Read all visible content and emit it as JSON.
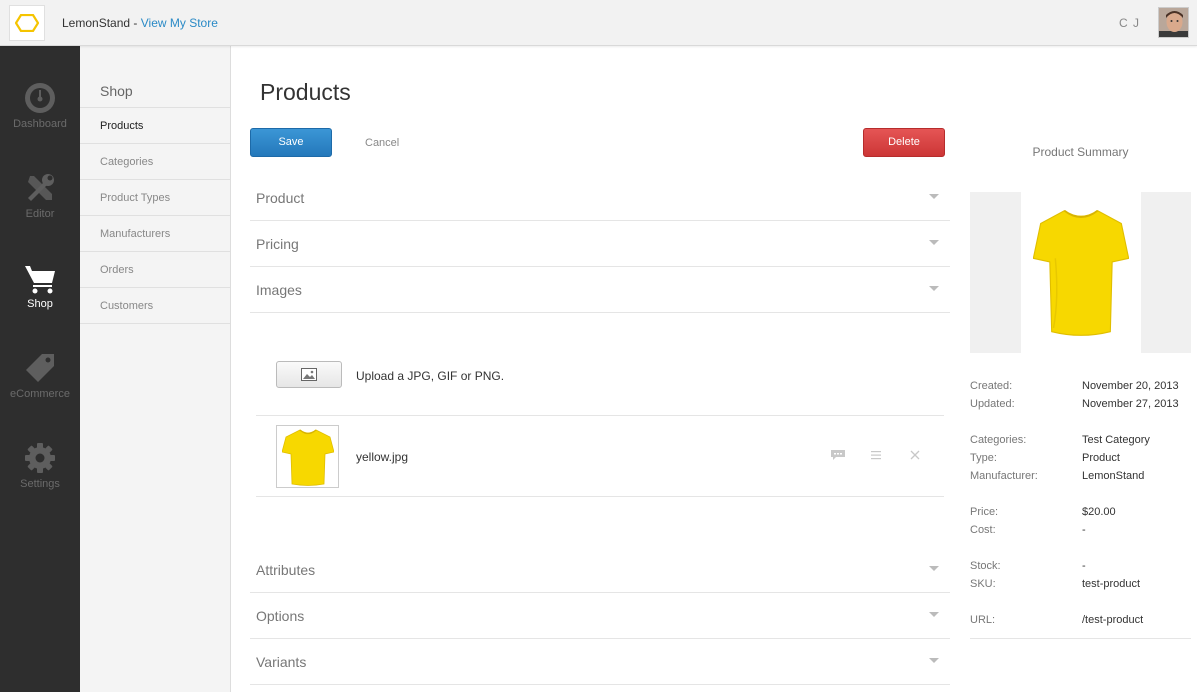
{
  "header": {
    "store_name": "LemonStand",
    "separator": " - ",
    "view_store_link": "View My Store",
    "user_initials": "C J"
  },
  "main_nav": [
    {
      "label": "Dashboard",
      "icon": "dashboard-icon"
    },
    {
      "label": "Editor",
      "icon": "tools-icon"
    },
    {
      "label": "Shop",
      "icon": "cart-icon"
    },
    {
      "label": "eCommerce",
      "icon": "tag-icon"
    },
    {
      "label": "Settings",
      "icon": "gear-icon"
    }
  ],
  "sub_nav": {
    "title": "Shop",
    "items": [
      {
        "label": "Products"
      },
      {
        "label": "Categories"
      },
      {
        "label": "Product Types"
      },
      {
        "label": "Manufacturers"
      },
      {
        "label": "Orders"
      },
      {
        "label": "Customers"
      }
    ]
  },
  "page": {
    "title": "Products",
    "save_label": "Save",
    "cancel_label": "Cancel",
    "delete_label": "Delete"
  },
  "sections": {
    "product": "Product",
    "pricing": "Pricing",
    "images": "Images",
    "attributes": "Attributes",
    "options": "Options",
    "variants": "Variants"
  },
  "images": {
    "upload_hint": "Upload a JPG, GIF or PNG.",
    "files": [
      {
        "name": "yellow.jpg"
      }
    ]
  },
  "summary": {
    "title": "Product Summary",
    "created_label": "Created:",
    "created_value": "November 20, 2013",
    "updated_label": "Updated:",
    "updated_value": "November 27, 2013",
    "categories_label": "Categories:",
    "categories_value": "Test Category",
    "type_label": "Type:",
    "type_value": "Product",
    "manufacturer_label": "Manufacturer:",
    "manufacturer_value": "LemonStand",
    "price_label": "Price:",
    "price_value": "$20.00",
    "cost_label": "Cost:",
    "cost_value": "-",
    "stock_label": "Stock:",
    "stock_value": "-",
    "sku_label": "SKU:",
    "sku_value": "test-product",
    "url_label": "URL:",
    "url_value": "/test-product"
  },
  "colors": {
    "brand_yellow": "#f5c400",
    "link_blue": "#2a8ac6",
    "save_blue": "#2a84c8",
    "delete_red": "#d83e3e",
    "nav_dark": "#2e2e2e"
  }
}
